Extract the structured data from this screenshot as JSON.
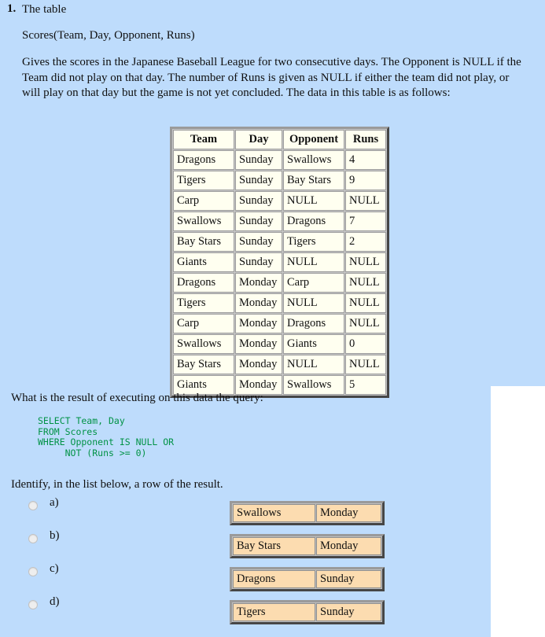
{
  "question": {
    "number": "1.",
    "title": "The table",
    "schema": "Scores(Team, Day, Opponent, Runs)",
    "description": "Gives the scores in the Japanese Baseball League for two consecutive days. The Opponent is NULL if the Team did not play on that day. The number of Runs is given as NULL if either the team did not play, or will play on that day but the game is not yet concluded. The data in this table is as follows:",
    "prompt": "What is the result of executing on this data the query:",
    "sql": "SELECT Team, Day\nFROM Scores\nWHERE Opponent IS NULL OR\n     NOT (Runs >= 0)",
    "identify": "Identify, in the list below, a row of the result."
  },
  "scores_table": {
    "headers": [
      "Team",
      "Day",
      "Opponent",
      "Runs"
    ],
    "rows": [
      [
        "Dragons",
        "Sunday",
        "Swallows",
        "4"
      ],
      [
        "Tigers",
        "Sunday",
        "Bay Stars",
        "9"
      ],
      [
        "Carp",
        "Sunday",
        "NULL",
        "NULL"
      ],
      [
        "Swallows",
        "Sunday",
        "Dragons",
        "7"
      ],
      [
        "Bay Stars",
        "Sunday",
        "Tigers",
        "2"
      ],
      [
        "Giants",
        "Sunday",
        "NULL",
        "NULL"
      ],
      [
        "Dragons",
        "Monday",
        "Carp",
        "NULL"
      ],
      [
        "Tigers",
        "Monday",
        "NULL",
        "NULL"
      ],
      [
        "Carp",
        "Monday",
        "Dragons",
        "NULL"
      ],
      [
        "Swallows",
        "Monday",
        "Giants",
        "0"
      ],
      [
        "Bay Stars",
        "Monday",
        "NULL",
        "NULL"
      ],
      [
        "Giants",
        "Monday",
        "Swallows",
        "5"
      ]
    ]
  },
  "options": [
    {
      "letter": "a)",
      "team": "Swallows",
      "day": "Monday"
    },
    {
      "letter": "b)",
      "team": "Bay Stars",
      "day": "Monday"
    },
    {
      "letter": "c)",
      "team": "Dragons",
      "day": "Sunday"
    },
    {
      "letter": "d)",
      "team": "Tigers",
      "day": "Sunday"
    }
  ],
  "colors": {
    "background": "#bedcfc",
    "cell_background": "#fffff0",
    "option_cell_background": "#fcdcb0",
    "sql_text": "#009245",
    "panel": "#ffffff"
  }
}
